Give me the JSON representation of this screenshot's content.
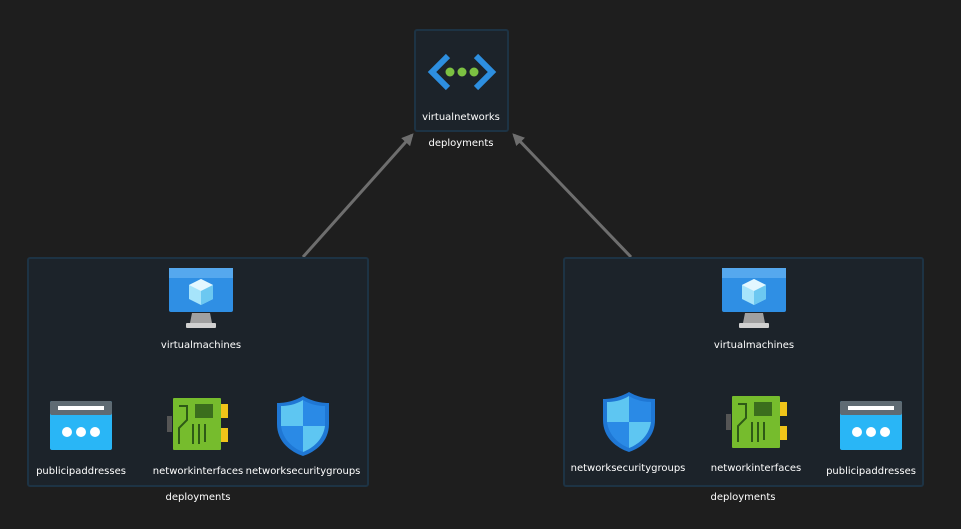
{
  "top_node": {
    "resource": "virtualnetworks",
    "group_label": "deployments"
  },
  "left_group": {
    "group_label": "deployments",
    "vm": "virtualmachines",
    "nic": "networkinterfaces",
    "pip": "publicipaddresses",
    "nsg": "networksecuritygroups"
  },
  "right_group": {
    "group_label": "deployments",
    "vm": "virtualmachines",
    "nic": "networkinterfaces",
    "pip": "publicipaddresses",
    "nsg": "networksecuritygroups"
  },
  "colors": {
    "background": "#1e1e1e",
    "box_fill": "#1c232a",
    "box_border": "#1d3344",
    "edge": "#6e6e6e",
    "azure_blue": "#2d8fe0",
    "nic_green": "#76bc2d",
    "nic_yellow": "#f0c419"
  },
  "icons": {
    "vnet": "virtual-network-icon",
    "vm": "virtual-machine-icon",
    "nic": "network-interface-icon",
    "pip": "public-ip-icon",
    "nsg": "network-security-group-icon"
  }
}
